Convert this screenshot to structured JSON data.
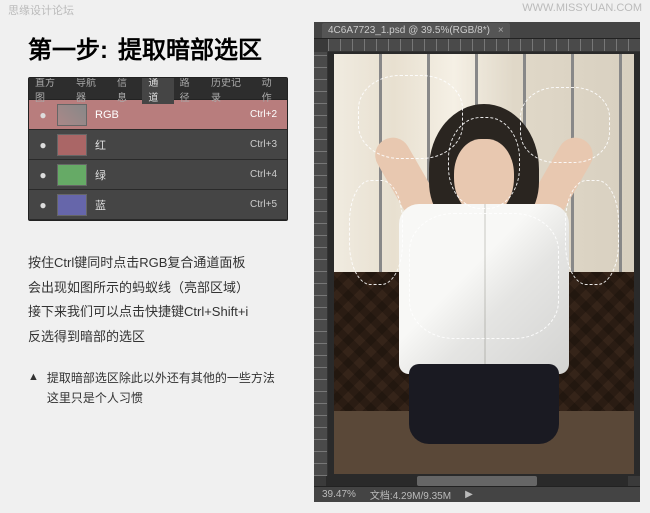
{
  "watermarks": {
    "tl": "思缘设计论坛",
    "tr": "WWW.MISSYUAN.COM"
  },
  "title": {
    "step": "第一步:",
    "text": "提取暗部选区"
  },
  "panel": {
    "tabs": [
      "直方图",
      "导航器",
      "信息",
      "通道",
      "路径",
      "历史记录",
      "动作"
    ],
    "active_tab": "通道",
    "channels": [
      {
        "name": "RGB",
        "short": "Ctrl+2",
        "eye": "●",
        "cls": "rgb",
        "sel": true
      },
      {
        "name": "红",
        "short": "Ctrl+3",
        "eye": "●",
        "cls": "r",
        "sel": false
      },
      {
        "name": "绿",
        "short": "Ctrl+4",
        "eye": "●",
        "cls": "g",
        "sel": false
      },
      {
        "name": "蓝",
        "short": "Ctrl+5",
        "eye": "●",
        "cls": "b",
        "sel": false
      }
    ]
  },
  "desc": {
    "l1": "按住Ctrl键同时点击RGB复合通道面板",
    "l2": "会出现如图所示的蚂蚁线（亮部区域）",
    "l3": "接下来我们可以点击快捷键Ctrl+Shift+i",
    "l4": "反选得到暗部的选区"
  },
  "note": {
    "tri": "▲",
    "l1": "提取暗部选区除此以外还有其他的一些方法",
    "l2": "这里只是个人习惯"
  },
  "ps": {
    "tab_title": "4C6A7723_1.psd @ 39.5%(RGB/8*)",
    "zoom": "39.47%",
    "doc": "文档:4.29M/9.35M"
  }
}
